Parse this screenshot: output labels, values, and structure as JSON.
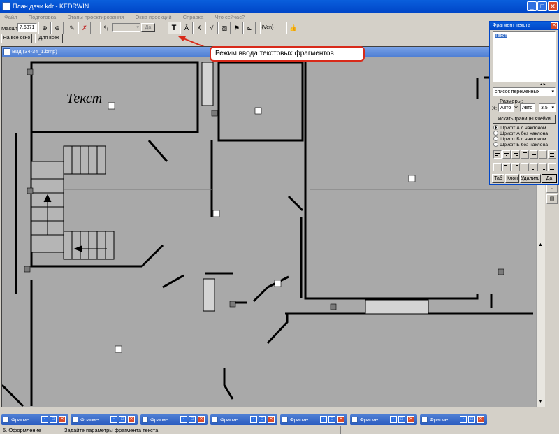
{
  "window": {
    "title": "План дачи.kdr - KEDRWIN"
  },
  "menu": [
    "Файл",
    "Подготовка",
    "Этапы проектирования",
    "Окна проекций",
    "Справка",
    "Что сейчас?"
  ],
  "toolbar": {
    "scale_label": "Масштаб",
    "scale_value": "7.6371",
    "fit_all_label": "На всё окно",
    "for_all_label": "Для всех",
    "disabled_button_label": "Да",
    "formula_label": "{Ven}"
  },
  "callout": {
    "text": "Режим ввода текстовых фрагментов"
  },
  "view": {
    "title": "Вид (34-34_1.bmp)",
    "plan_text": "Текст"
  },
  "fragment_panel": {
    "title": "Фрагмент текста",
    "text_value": "Текст",
    "list_value": "список переменных",
    "sizes_label": "Размеры:",
    "x_label": "X:",
    "x_value": "Авто",
    "y_label": "Y:",
    "y_value": "Авто",
    "font_size": "3.5",
    "find_button": "Искать границы ячейки",
    "fonts": [
      {
        "label": "Шрифт А с наклоном",
        "selected": true
      },
      {
        "label": "Шрифт А без наклона",
        "selected": false
      },
      {
        "label": "Шрифт Б с наклоном",
        "selected": false
      },
      {
        "label": "Шрифт Б без наклона",
        "selected": false
      }
    ],
    "buttons": [
      "Таб",
      "Клон",
      "Удалить",
      "Да"
    ]
  },
  "taskbar": {
    "windows": [
      "Фрагме...",
      "Фрагме...",
      "Фрагме...",
      "Фрагме...",
      "Фрагме...",
      "Фрагме...",
      "Фрагме..."
    ]
  },
  "status": {
    "mode": "5. Оформление",
    "hint": "Задайте параметры фрагмента текста"
  },
  "colors": {
    "title_blue": "#0046c8",
    "accent_red": "#d82a1a",
    "plan_gray": "#a9a9a9"
  }
}
